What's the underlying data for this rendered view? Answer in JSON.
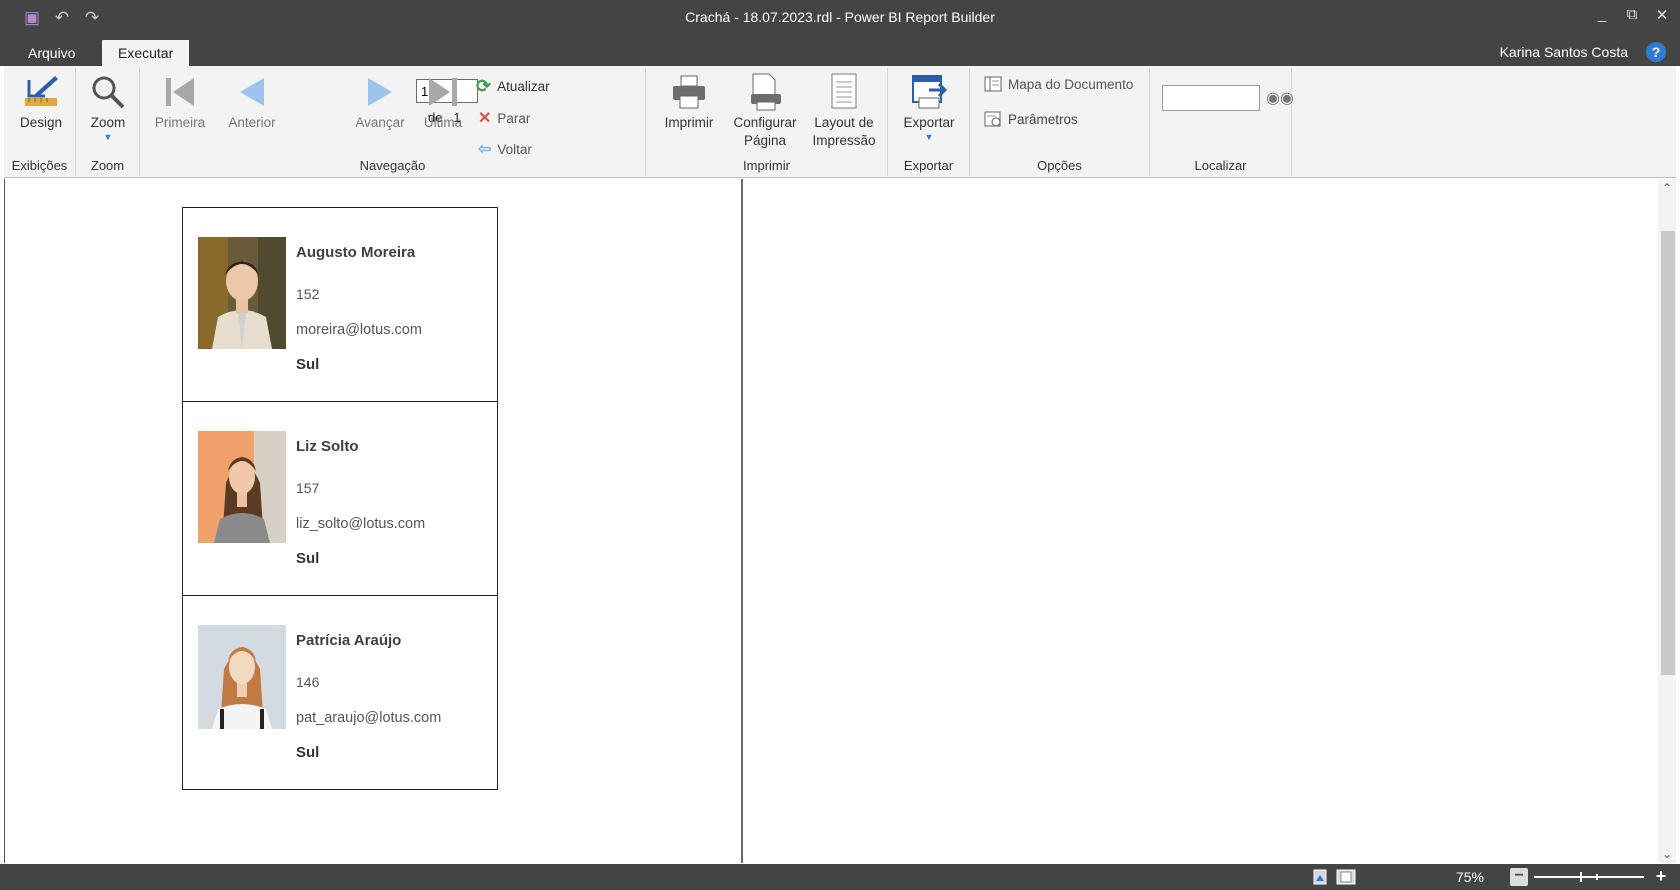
{
  "window": {
    "title": "Crachá - 18.07.2023.rdl - Power BI Report Builder",
    "user": "Karina Santos Costa",
    "help": "?"
  },
  "tabs": [
    {
      "label": "Arquivo",
      "active": false
    },
    {
      "label": "Executar",
      "active": true
    }
  ],
  "ribbon": {
    "views": {
      "label": "Exibições",
      "design": "Design"
    },
    "zoom": {
      "label": "Zoom",
      "zoom": "Zoom"
    },
    "navigation": {
      "label": "Navegação",
      "first": "Primeira",
      "previous": "Anterior",
      "page_value": "1",
      "of_label": "de",
      "page_total": "1",
      "next": "Avançar",
      "last": "Última",
      "refresh": "Atualizar",
      "stop": "Parar",
      "back": "Voltar"
    },
    "print": {
      "label": "Imprimir",
      "print": "Imprimir",
      "page_setup_line1": "Configurar",
      "page_setup_line2": "Página",
      "print_layout_line1": "Layout de",
      "print_layout_line2": "Impressão"
    },
    "export": {
      "label": "Exportar",
      "export": "Exportar"
    },
    "options": {
      "label": "Opções",
      "doc_map": "Mapa do Documento",
      "parameters": "Parâmetros"
    },
    "find": {
      "label": "Localizar",
      "value": ""
    }
  },
  "report": {
    "cards": [
      {
        "name": "Augusto Moreira",
        "number": "152",
        "email": "moreira@lotus.com",
        "region": "Sul"
      },
      {
        "name": "Liz Solto",
        "number": "157",
        "email": "liz_solto@lotus.com",
        "region": "Sul"
      },
      {
        "name": "Patrícia Araújo",
        "number": "146",
        "email": "pat_araujo@lotus.com",
        "region": "Sul"
      }
    ]
  },
  "status": {
    "zoom": "75%"
  },
  "colors": {
    "chrome": "#444444",
    "ribbon": "#f3f3f3",
    "accent_blue": "#2e7bd1"
  }
}
